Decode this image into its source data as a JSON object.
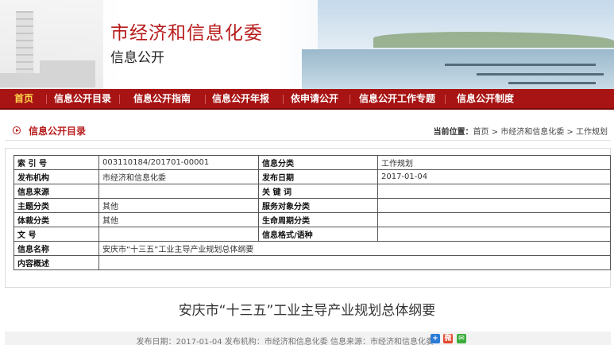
{
  "header": {
    "title": "市经济和信息化委",
    "subtitle": "信息公开"
  },
  "nav": {
    "items": [
      "首页",
      "信息公开目录",
      "信息公开指南",
      "信息公开年报",
      "依申请公开",
      "信息公开工作专题",
      "信息公开制度"
    ]
  },
  "section": {
    "title": "信息公开目录",
    "crumb_label": "当前位置：",
    "crumb_path": "首页 > 市经济和信息化委 > 工作规划"
  },
  "info": {
    "rows": [
      {
        "k1": "索 引 号",
        "v1": "003110184/201701-00001",
        "k2": "信息分类",
        "v2": "工作规划"
      },
      {
        "k1": "发布机构",
        "v1": "市经济和信息化委",
        "k2": "发布日期",
        "v2": "2017-01-04"
      },
      {
        "k1": "信息来源",
        "v1": "",
        "k2": "关 键 词",
        "v2": ""
      },
      {
        "k1": "主题分类",
        "v1": "其他",
        "k2": "服务对象分类",
        "v2": ""
      },
      {
        "k1": "体裁分类",
        "v1": "其他",
        "k2": "生命周期分类",
        "v2": ""
      },
      {
        "k1": "文 号",
        "v1": "",
        "k2": "信息格式/语种",
        "v2": ""
      }
    ],
    "name_label": "信息名称",
    "name_value": "安庆市“十三五”工业主导产业规划总体纲要",
    "summary_label": "内容概述",
    "summary_value": ""
  },
  "document": {
    "title": "安庆市“十三五”工业主导产业规划总体纲要",
    "meta": "发布日期：2017-01-04   发布机构：市经济和信息化委   信息来源：市经济和信息化委"
  },
  "share_icons": [
    "plus-share-icon",
    "weibo-icon",
    "wechat-icon"
  ],
  "colors": {
    "nav_bg": "#a81313",
    "accent_red": "#b81b1b",
    "nav_active": "#ffd54a"
  }
}
